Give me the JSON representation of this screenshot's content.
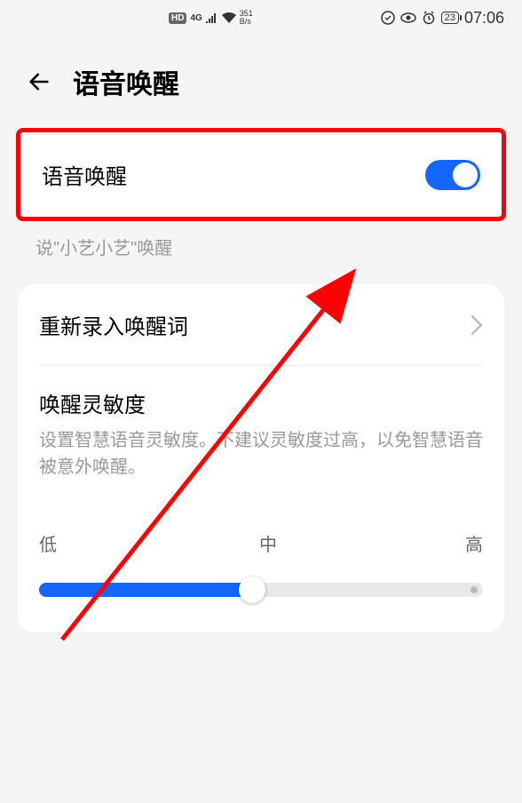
{
  "status": {
    "hd": "HD",
    "net4g": "4G",
    "speed_top": "351",
    "speed_bottom": "B/s",
    "battery": "23",
    "time": "07:06"
  },
  "header": {
    "title": "语音唤醒"
  },
  "voice_wake": {
    "label": "语音唤醒",
    "hint": "说\"小艺小艺\"唤醒"
  },
  "rerecord": {
    "label": "重新录入唤醒词"
  },
  "sensitivity": {
    "title": "唤醒灵敏度",
    "desc": "设置智慧语音灵敏度。不建议灵敏度过高，以免智慧语音被意外唤醒。",
    "low": "低",
    "mid": "中",
    "high": "高"
  }
}
